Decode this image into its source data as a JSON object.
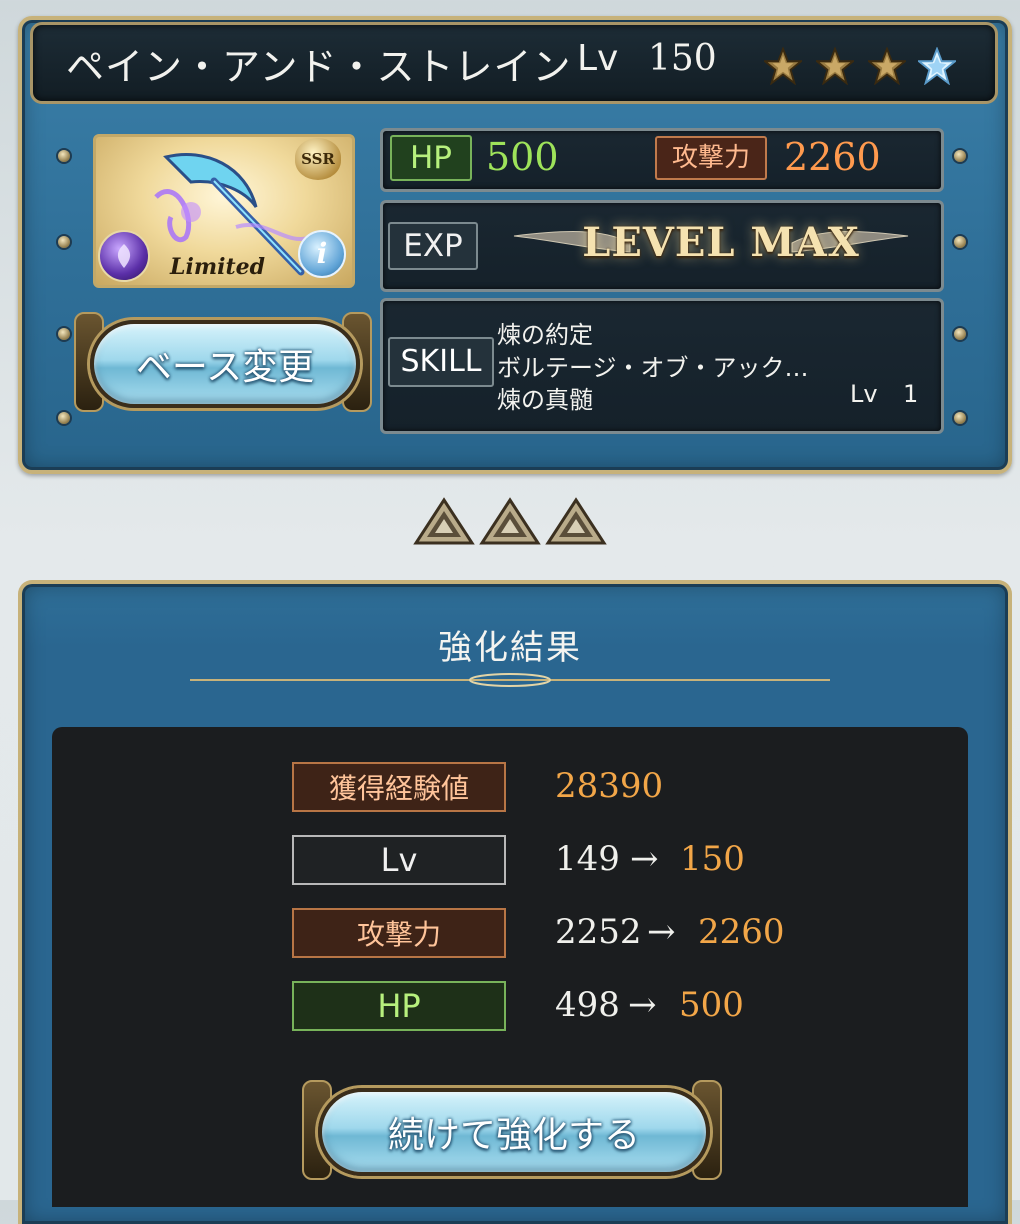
{
  "weapon": {
    "name": "ペイン・アンド・ストレイン",
    "level_label": "Lv",
    "level": "150",
    "rarity_badge": "SSR",
    "limited_label": "Limited",
    "info_glyph": "i",
    "stars": [
      "uncap-star-filled",
      "uncap-star-filled",
      "uncap-star-filled",
      "uncap-star-blue"
    ],
    "element_icon": "dark-element-icon"
  },
  "stats": {
    "hp_label": "HP",
    "hp": "500",
    "atk_label": "攻撃力",
    "atk": "2260",
    "exp_label": "EXP",
    "exp_status": "LEVEL MAX"
  },
  "skills": {
    "label": "SKILL",
    "items": [
      "煉の約定",
      "ボルテージ・オブ・アック…",
      "煉の真髄"
    ],
    "level_label": "Lv",
    "level": "1"
  },
  "buttons": {
    "base_change": "ベース変更",
    "continue_upgrade": "続けて強化する"
  },
  "result": {
    "title": "強化結果",
    "arrow": "→",
    "exp_gained_label": "獲得経験値",
    "exp_gained": "28390",
    "lv_label": "Lv",
    "lv_before": "149",
    "lv_after": "150",
    "atk_label": "攻撃力",
    "atk_before": "2252",
    "atk_after": "2260",
    "hp_label": "HP",
    "hp_before": "498",
    "hp_after": "500"
  },
  "colors": {
    "frame_gold": "#c7b27a",
    "panel_blue": "#2f6f98",
    "hp_green": "#9ee35a",
    "atk_orange": "#ff9a4e",
    "result_orange": "#f2a648"
  }
}
